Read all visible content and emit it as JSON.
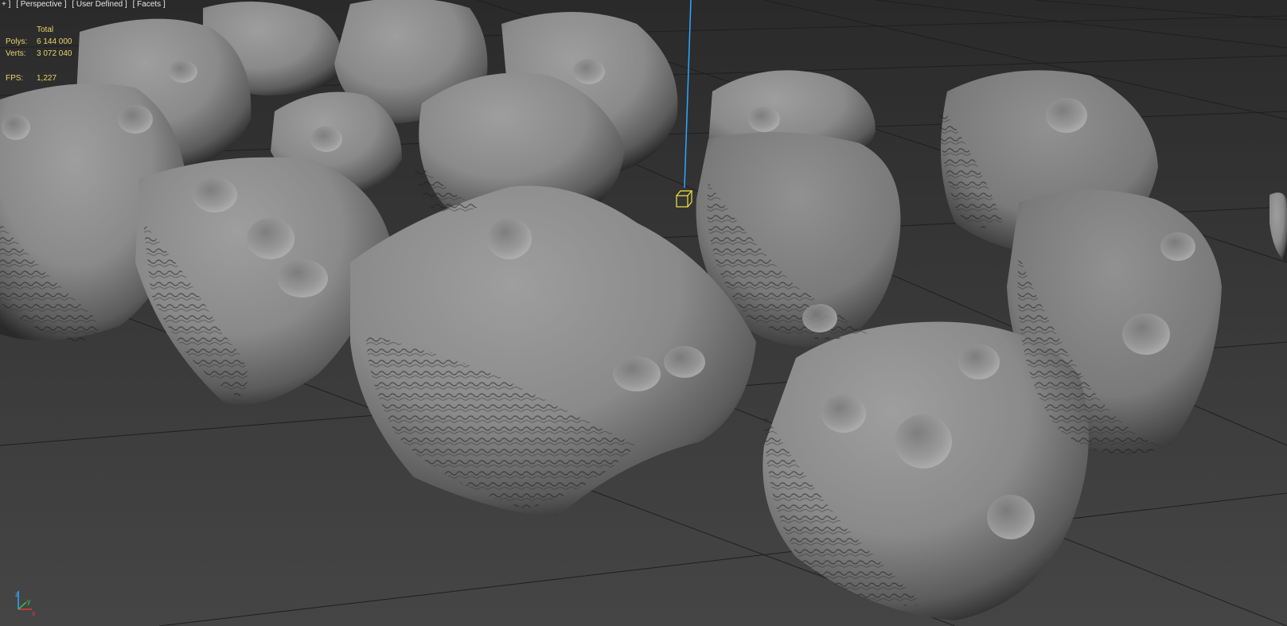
{
  "viewport": {
    "labels": [
      "+ ]",
      "[ Perspective ]",
      "[ User Defined ]",
      "[ Facets ]"
    ]
  },
  "stats": {
    "header": "Total",
    "polys_label": "Polys:",
    "polys_value": "6 144 000",
    "verts_label": "Verts:",
    "verts_value": "3 072 040",
    "fps_label": "FPS:",
    "fps_value": "1,227"
  },
  "axis": {
    "z": "z",
    "y": "y",
    "x": "x"
  },
  "colors": {
    "background": "#3a3a3a",
    "grid": "#202020",
    "rock": "#8e8e8e",
    "rock_shadow": "#1e1e1e",
    "stats_text": "#e8d36a",
    "light_line": "#2aa8ff",
    "light_gizmo": "#f2e640"
  },
  "icons": {
    "axis_tripod": "axis-tripod-icon",
    "light_target": "light-target-icon"
  }
}
